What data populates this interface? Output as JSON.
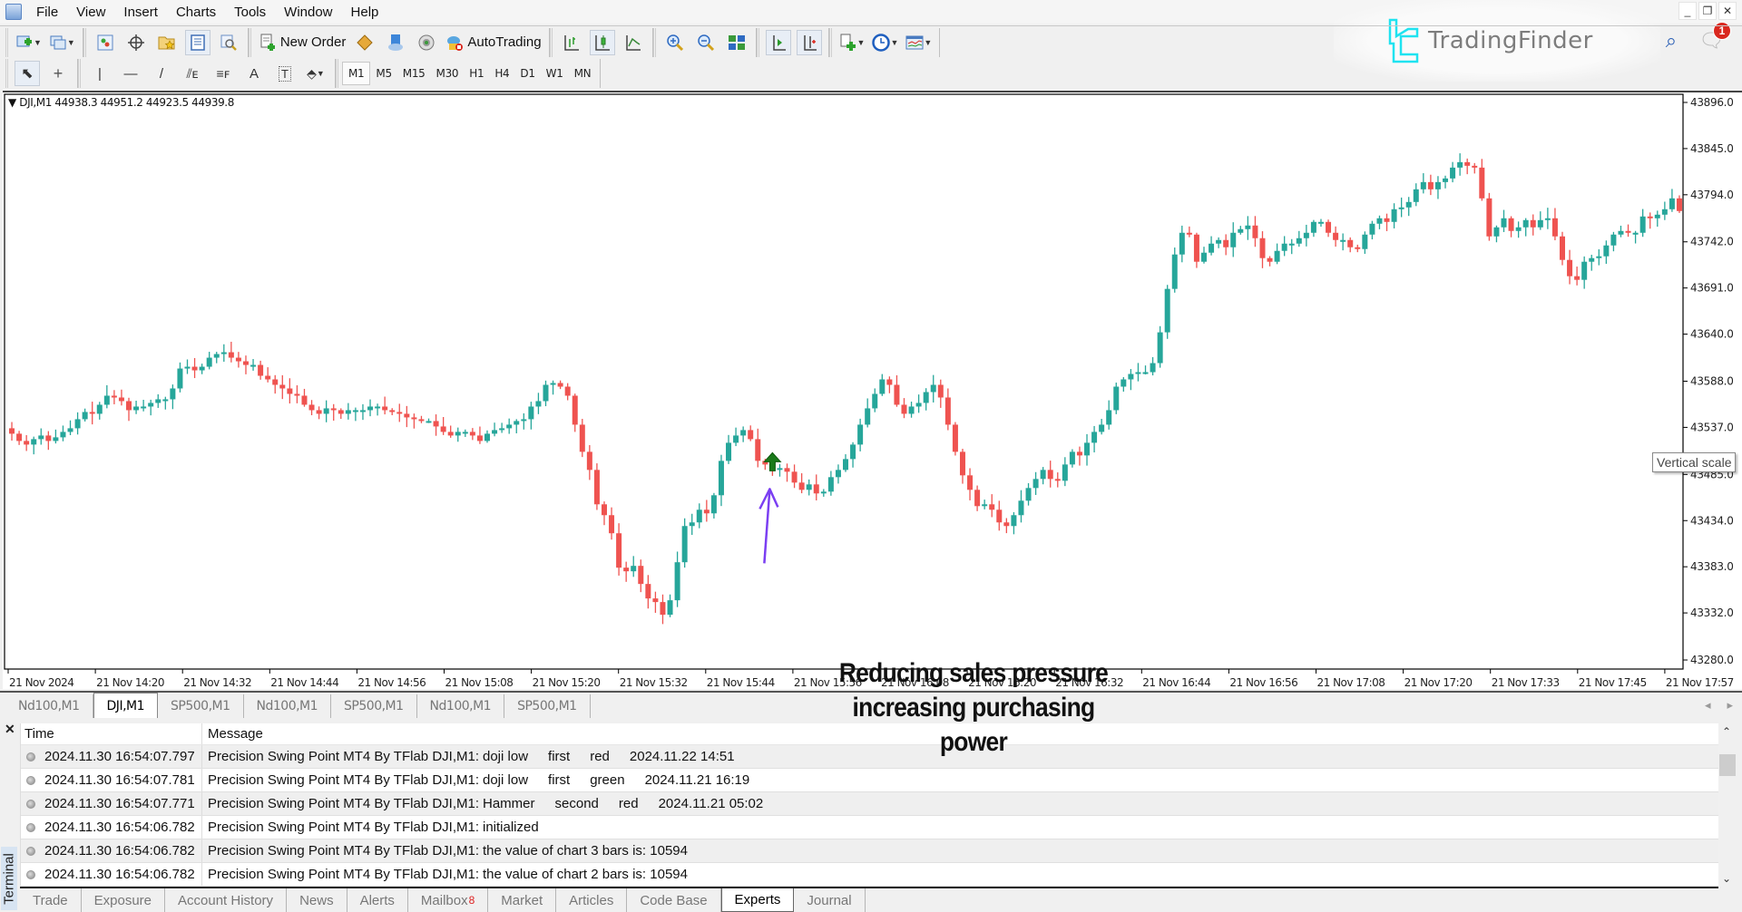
{
  "menu": {
    "items": [
      "File",
      "View",
      "Insert",
      "Charts",
      "Tools",
      "Window",
      "Help"
    ]
  },
  "window_controls": [
    "minimize",
    "restore",
    "close"
  ],
  "toolbar": {
    "new_order_label": "New Order",
    "autotrading_label": "AutoTrading",
    "buttons": [
      "new-chart",
      "profiles",
      "market-watch",
      "navigator-crosshair",
      "favorites",
      "data-window",
      "strategy-tester",
      "new-order",
      "metaeditor",
      "cloud",
      "signals",
      "autotrading",
      "bar-chart",
      "candlesticks",
      "line-chart",
      "zoom-in",
      "zoom-out",
      "tile-windows",
      "chart-shift",
      "auto-scroll",
      "indicators",
      "periods",
      "templates"
    ]
  },
  "drawing_tools": [
    "cursor",
    "crosshair",
    "vertical-line",
    "horizontal-line",
    "trendline",
    "equidistant-channel",
    "fibonacci",
    "text",
    "text-label",
    "arrows"
  ],
  "timeframes": {
    "items": [
      "M1",
      "M5",
      "M15",
      "M30",
      "H1",
      "H4",
      "D1",
      "W1",
      "MN"
    ],
    "active": "M1"
  },
  "brand": {
    "name": "TradingFinder",
    "accent": "#1fe3f0"
  },
  "notifications": {
    "count": "1"
  },
  "chart": {
    "symbol_header": "DJI,M1",
    "ohlc_header": "44938.3 44951.2 44923.5 44939.8",
    "tooltip": "Vertical scale",
    "annotation_line1": "Reducing sales pressure",
    "annotation_line2": "increasing purchasing power",
    "bull_color": "#26a69a",
    "bear_color": "#ef5350",
    "signal_arrow_color": "#1a7a1a",
    "pointer_arrow_color": "#7b3ff2"
  },
  "chart_data": {
    "type": "candlestick",
    "symbol": "DJI",
    "timeframe": "M1",
    "ylim": [
      43270,
      43905
    ],
    "y_ticks": [
      "43896.0",
      "43845.0",
      "43794.0",
      "43742.0",
      "43691.0",
      "43640.0",
      "43588.0",
      "43537.0",
      "43485.0",
      "43434.0",
      "43383.0",
      "43332.0",
      "43280.0"
    ],
    "x_ticks": [
      "21 Nov 2024",
      "21 Nov 14:20",
      "21 Nov 14:32",
      "21 Nov 14:44",
      "21 Nov 14:56",
      "21 Nov 15:08",
      "21 Nov 15:20",
      "21 Nov 15:32",
      "21 Nov 15:44",
      "21 Nov 15:56",
      "21 Nov 16:08",
      "21 Nov 16:20",
      "21 Nov 16:32",
      "21 Nov 16:44",
      "21 Nov 16:56",
      "21 Nov 17:08",
      "21 Nov 17:20",
      "21 Nov 17:33",
      "21 Nov 17:45",
      "21 Nov 17:57"
    ],
    "signal": {
      "type": "buy-arrow",
      "candle_index": 104,
      "price": 43509
    },
    "closes": [
      43530,
      43522,
      43518,
      43524,
      43528,
      43522,
      43526,
      43532,
      43536,
      43546,
      43554,
      43552,
      43562,
      43572,
      43570,
      43566,
      43556,
      43560,
      43560,
      43564,
      43568,
      43568,
      43580,
      43602,
      43604,
      43600,
      43604,
      43614,
      43618,
      43620,
      43614,
      43610,
      43606,
      43606,
      43594,
      43590,
      43584,
      43580,
      43574,
      43572,
      43562,
      43556,
      43552,
      43558,
      43556,
      43552,
      43556,
      43556,
      43556,
      43560,
      43560,
      43556,
      43554,
      43552,
      43548,
      43546,
      43544,
      43544,
      43538,
      43532,
      43528,
      43532,
      43532,
      43528,
      43522,
      43530,
      43534,
      43536,
      43540,
      43544,
      43546,
      43560,
      43566,
      43584,
      43586,
      43582,
      43572,
      43540,
      43510,
      43490,
      43452,
      43440,
      43420,
      43382,
      43378,
      43384,
      43364,
      43348,
      43344,
      43330,
      43346,
      43388,
      43428,
      43432,
      43446,
      43442,
      43462,
      43500,
      43520,
      43528,
      43534,
      43524,
      43500,
      43496,
      43492,
      43492,
      43488,
      43476,
      43468,
      43474,
      43464,
      43466,
      43482,
      43490,
      43502,
      43518,
      43540,
      43558,
      43574,
      43590,
      43584,
      43562,
      43552,
      43560,
      43564,
      43576,
      43584,
      43570,
      43540,
      43510,
      43484,
      43468,
      43450,
      43452,
      43446,
      43432,
      43428,
      43440,
      43456,
      43470,
      43480,
      43490,
      43480,
      43478,
      43496,
      43510,
      43506,
      43520,
      43532,
      43540,
      43556,
      43582,
      43590,
      43596,
      43598,
      43598,
      43608,
      43642,
      43690,
      43728,
      43752,
      43750,
      43720,
      43730,
      43740,
      43744,
      43736,
      43752,
      43756,
      43760,
      43746,
      43724,
      43720,
      43732,
      43740,
      43740,
      43746,
      43752,
      43764,
      43764,
      43752,
      43744,
      43744,
      43736,
      43734,
      43750,
      43762,
      43768,
      43764,
      43778,
      43780,
      43786,
      43800,
      43808,
      43800,
      43808,
      43812,
      43824,
      43830,
      43826,
      43824,
      43790,
      43748,
      43758,
      43768,
      43754,
      43758,
      43766,
      43758,
      43766,
      43768,
      43748,
      43722,
      43704,
      43700,
      43720,
      43724,
      43726,
      43738,
      43750,
      43754,
      43752,
      43752,
      43770,
      43768,
      43772,
      43778,
      43790,
      43776
    ]
  },
  "chart_tabs": {
    "items": [
      "Nd100,M1",
      "DJI,M1",
      "SP500,M1",
      "Nd100,M1",
      "SP500,M1",
      "Nd100,M1",
      "SP500,M1"
    ],
    "active_index": 1
  },
  "terminal": {
    "label": "Terminal",
    "columns": {
      "time": "Time",
      "message": "Message"
    },
    "rows": [
      {
        "time": "2024.11.30 16:54:07.797",
        "source": "Precision Swing Point MT4 By TFlab DJI,M1:",
        "parts": [
          "doji low",
          "first",
          "red",
          "2024.11.22 14:51"
        ]
      },
      {
        "time": "2024.11.30 16:54:07.781",
        "source": "Precision Swing Point MT4 By TFlab DJI,M1:",
        "parts": [
          "doji low",
          "first",
          "green",
          "2024.11.21 16:19"
        ]
      },
      {
        "time": "2024.11.30 16:54:07.771",
        "source": "Precision Swing Point MT4 By TFlab DJI,M1:",
        "parts": [
          "Hammer",
          "second",
          "red",
          "2024.11.21 05:02"
        ]
      },
      {
        "time": "2024.11.30 16:54:06.782",
        "source": "Precision Swing Point MT4 By TFlab DJI,M1:",
        "parts": [
          "initialized"
        ]
      },
      {
        "time": "2024.11.30 16:54:06.782",
        "source": "Precision Swing Point MT4 By TFlab DJI,M1:",
        "parts": [
          "the value of chart 3 bars is: 10594"
        ]
      },
      {
        "time": "2024.11.30 16:54:06.782",
        "source": "Precision Swing Point MT4 By TFlab DJI,M1:",
        "parts": [
          "the value of chart 2 bars is: 10594"
        ]
      }
    ],
    "tabs": [
      "Trade",
      "Exposure",
      "Account History",
      "News",
      "Alerts",
      "Mailbox",
      "Market",
      "Articles",
      "Code Base",
      "Experts",
      "Journal"
    ],
    "mailbox_badge": "8",
    "active_tab": "Experts"
  }
}
